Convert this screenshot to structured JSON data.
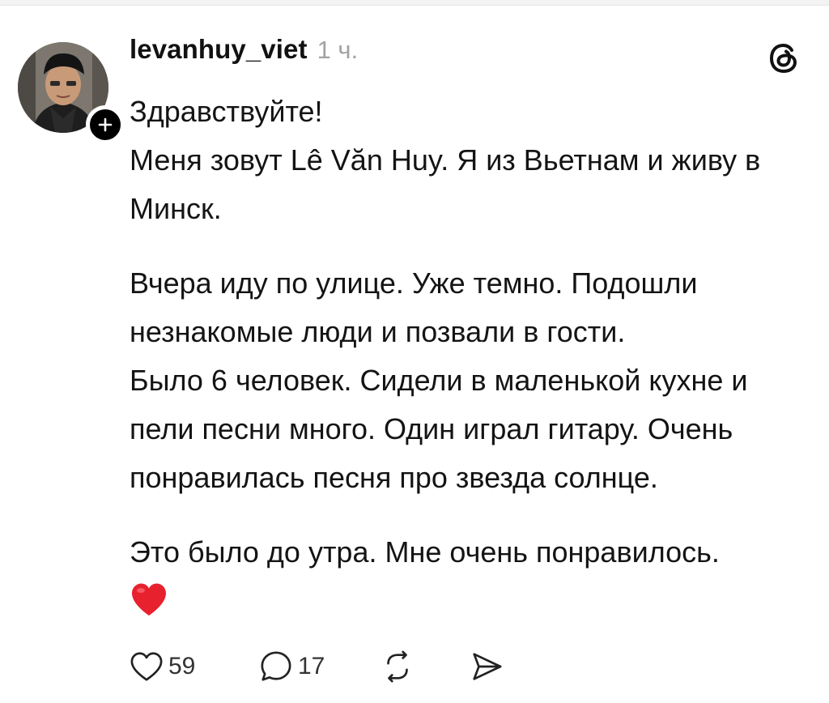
{
  "post": {
    "username": "levanhuy_viet",
    "timestamp": "1 ч.",
    "paragraphs": [
      "Здравствуйте!",
      "Меня зовут Lê Văn Huy. Я из Вьетнам и живу в Минск.",
      "Вчера иду по улице. Уже темно. Подошли незнакомые люди и позвали в гости.",
      "Было 6 человек. Сидели в маленькой кухне и пели песни много. Один играл гитару. Очень  понравилась песня про звезда солнце.",
      "Это было до утра. Мне очень понравилось."
    ],
    "emoji": "heart-emoji"
  },
  "actions": {
    "likes": "59",
    "replies": "17"
  },
  "icons": {
    "avatar": "avatar",
    "follow": "plus-icon",
    "brand": "threads-logo-icon",
    "like": "heart-outline-icon",
    "reply": "speech-bubble-icon",
    "repost": "repost-icon",
    "share": "send-icon"
  },
  "colors": {
    "text": "#141414",
    "muted": "#a3a3a3",
    "heart": "#e8212e",
    "badge": "#000000"
  }
}
